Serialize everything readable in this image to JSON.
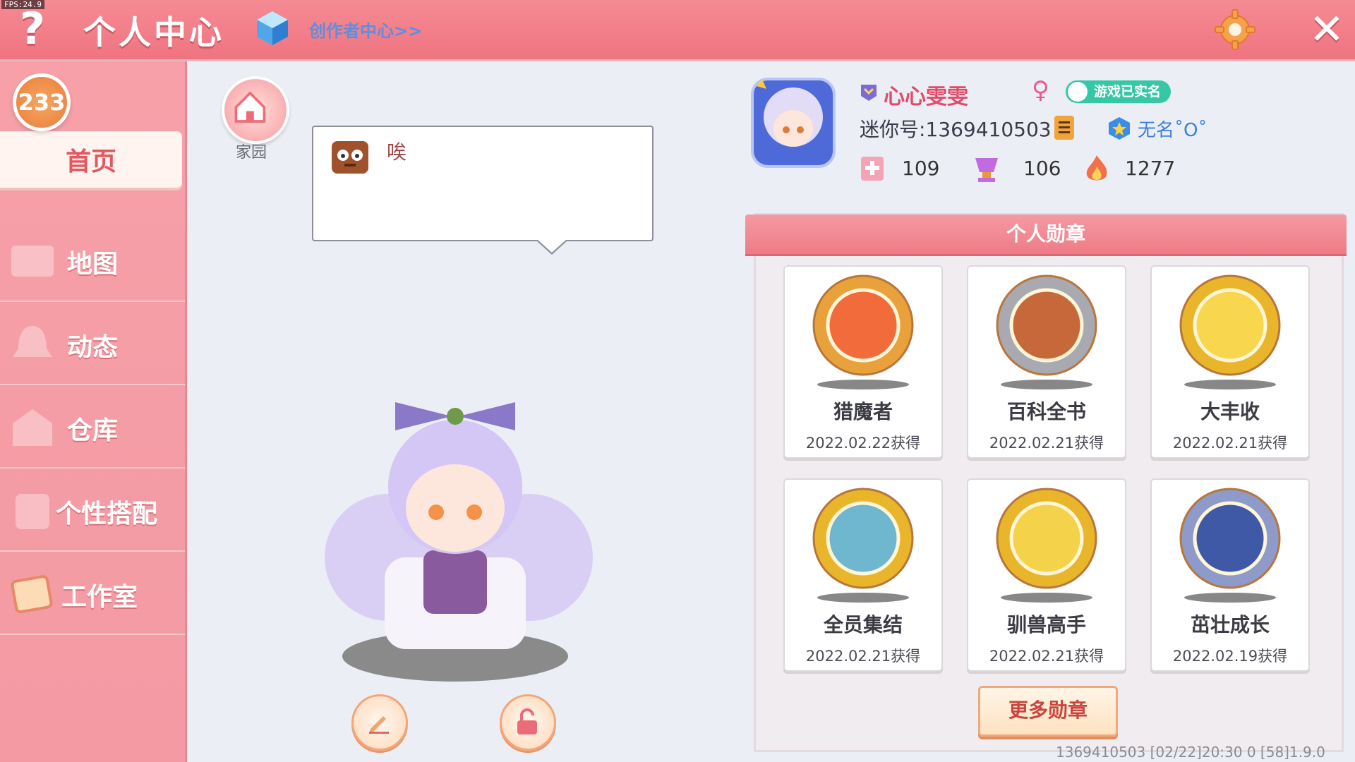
{
  "debug": {
    "fps": "FPS:24.9"
  },
  "header": {
    "help_icon": "?",
    "title": "个人中心",
    "creator_link": "创作者中心>>",
    "close_icon": "✕"
  },
  "sidebar": {
    "badge_count": "233",
    "items": [
      {
        "label": "首页",
        "active": true
      },
      {
        "label": "地图"
      },
      {
        "label": "动态"
      },
      {
        "label": "仓库"
      },
      {
        "label": "个性搭配"
      },
      {
        "label": "工作室"
      }
    ]
  },
  "middle": {
    "home_label": "家园",
    "bubble_text": "唉"
  },
  "profile": {
    "name": "心心雯雯",
    "gender_icon": "♀",
    "real_name_badge": "游戏已实名",
    "mini_id": "迷你号:1369410503",
    "clan": "无名˚O˚",
    "stats": {
      "flags": "109",
      "trophies": "106",
      "fire": "1277"
    }
  },
  "medals": {
    "header": "个人勋章",
    "more_button": "更多勋章",
    "items": [
      {
        "name": "猎魔者",
        "date": "2022.02.22获得",
        "ring": "#e9a23b",
        "inner": "#f26b3a"
      },
      {
        "name": "百科全书",
        "date": "2022.02.21获得",
        "ring": "#a9a9b2",
        "inner": "#c7683a"
      },
      {
        "name": "大丰收",
        "date": "2022.02.21获得",
        "ring": "#e9b52a",
        "inner": "#f8d64e"
      },
      {
        "name": "全员集结",
        "date": "2022.02.21获得",
        "ring": "#e9b52a",
        "inner": "#6fb6cf"
      },
      {
        "name": "驯兽高手",
        "date": "2022.02.21获得",
        "ring": "#e9b52a",
        "inner": "#f4d24a"
      },
      {
        "name": "茁壮成长",
        "date": "2022.02.19获得",
        "ring": "#8e9ac9",
        "inner": "#3f59a6"
      }
    ]
  },
  "footer": {
    "text": "1369410503   [02/22]20:30 0  [58]1.9.0"
  },
  "colors": {
    "accent": "#ef7480",
    "sidebar": "#f39aa3",
    "name": "#e24a68",
    "link": "#5c8fe0"
  }
}
